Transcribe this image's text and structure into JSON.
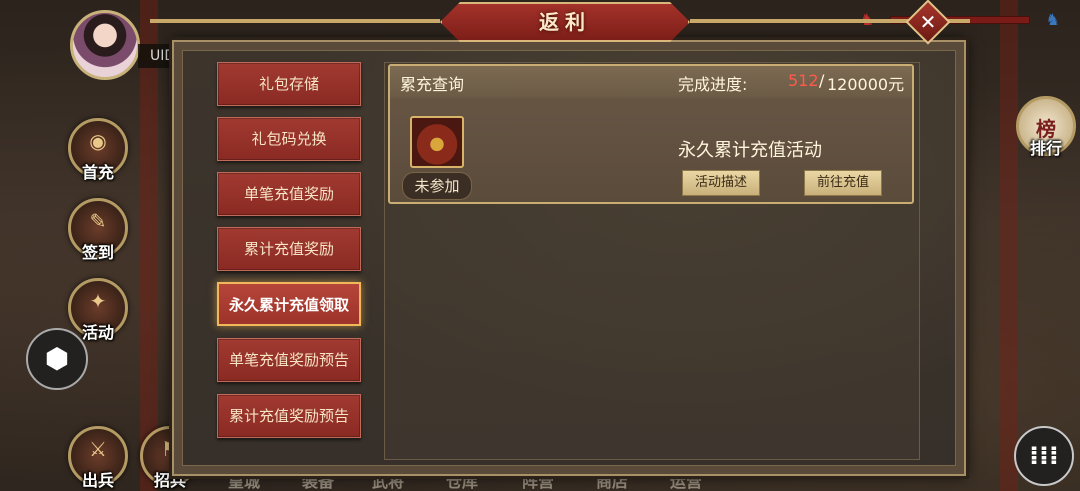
{
  "window": {
    "title": "返利"
  },
  "player": {
    "uid_label": "UID"
  },
  "side_buttons": {
    "first_charge": "首充",
    "sign_in": "签到",
    "activity": "活动",
    "expedition": "出兵",
    "ranking": "排行",
    "ranking_icon_char": "榜"
  },
  "bottom_nav": [
    "招兵",
    "皇城",
    "装备",
    "武将",
    "仓库",
    "阵营",
    "商店",
    "运营"
  ],
  "menu": {
    "items": [
      {
        "label": "礼包存储",
        "active": false
      },
      {
        "label": "礼包码兑换",
        "active": false
      },
      {
        "label": "单笔充值奖励",
        "active": false
      },
      {
        "label": "累计充值奖励",
        "active": false
      },
      {
        "label": "永久累计充值领取",
        "active": true
      },
      {
        "label": "单笔充值奖励预告",
        "active": false
      },
      {
        "label": "累计充值奖励预告",
        "active": false
      }
    ]
  },
  "card": {
    "title": "累充查询",
    "progress_label": "完成进度:",
    "progress_current": "512",
    "progress_separator": "/",
    "progress_goal": "120000元",
    "status": "未参加",
    "activity_name": "永久累计充值活动",
    "describe_button": "活动描述",
    "recharge_button": "前往充值"
  },
  "colors": {
    "accent_red": "#9d3329",
    "gold_border": "#c9ad72",
    "progress_highlight": "#ff5a4a"
  },
  "icons": {
    "close": "close-icon",
    "chest": "treasure-chest-icon",
    "float": "cube-icon",
    "menu": "more-menu-icon"
  }
}
